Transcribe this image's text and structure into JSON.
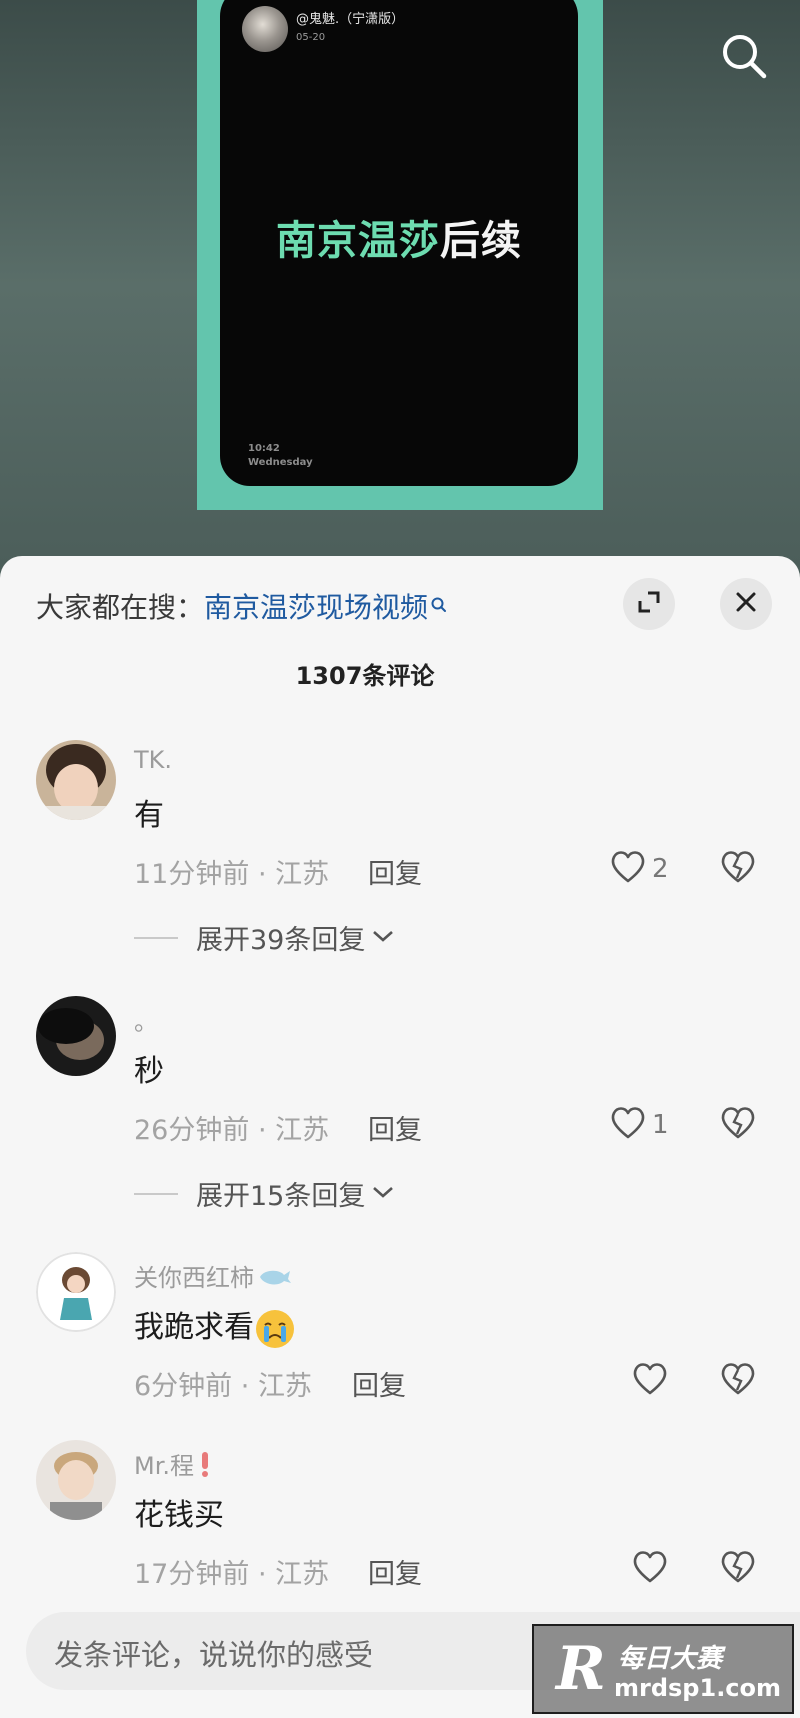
{
  "video": {
    "poster_user": "@鬼魅.（宁潇版）",
    "poster_date": "05-20",
    "title_highlight": "南京温莎",
    "title_rest": "后续",
    "poster_time": "10:42",
    "poster_day": "Wednesday"
  },
  "sheet": {
    "trending_label": "大家都在搜：",
    "trending_query": "南京温莎现场视频",
    "comment_count": "1307条评论",
    "icons": {
      "expand": "expand-icon",
      "close": "close-icon",
      "search": "search-icon"
    }
  },
  "comments": [
    {
      "name": "TK.",
      "text": "有",
      "time": "11分钟前",
      "location": "江苏",
      "reply_label": "回复",
      "likes": "2",
      "expand_label": "展开39条回复"
    },
    {
      "name": "。",
      "text": "秒",
      "time": "26分钟前",
      "location": "江苏",
      "reply_label": "回复",
      "likes": "1",
      "expand_label": "展开15条回复"
    },
    {
      "name": "关你西红柿",
      "text": "我跪求看",
      "time": "6分钟前",
      "location": "江苏",
      "reply_label": "回复",
      "likes": ""
    },
    {
      "name": "Mr.程",
      "text": "花钱买",
      "time": "17分钟前",
      "location": "江苏",
      "reply_label": "回复",
      "likes": ""
    }
  ],
  "input": {
    "placeholder": "发条评论，说说你的感受"
  },
  "watermark": {
    "letter": "R",
    "brand": "每日大赛",
    "url": "mrdsp1.com"
  },
  "colors": {
    "accent_green": "#6ddcb0",
    "link_blue": "#1f5aa0",
    "sheet_bg": "#f6f6f6"
  }
}
